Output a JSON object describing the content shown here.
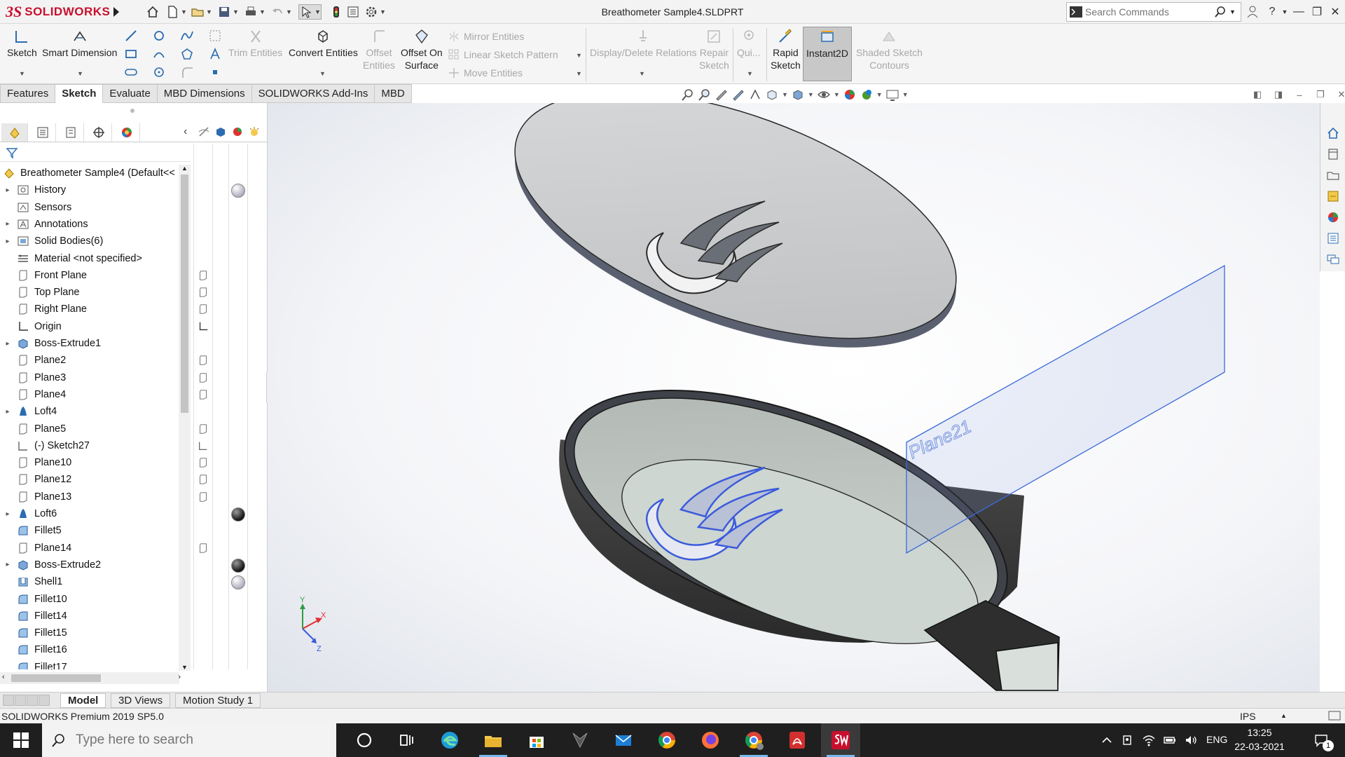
{
  "app": {
    "logo_ds": "3S",
    "logo_name": "SOLIDWORKS",
    "document_title": "Breathometer Sample4.SLDPRT",
    "search_placeholder": "Search Commands"
  },
  "ribbon": {
    "sketch": "Sketch",
    "smart_dimension": "Smart Dimension",
    "trim_entities": "Trim Entities",
    "convert_entities": "Convert Entities",
    "offset_entities_1": "Offset",
    "offset_entities_2": "Entities",
    "offset_on_surface_1": "Offset On",
    "offset_on_surface_2": "Surface",
    "mirror_entities": "Mirror Entities",
    "linear_sketch_pattern": "Linear Sketch Pattern",
    "move_entities": "Move Entities",
    "display_delete_relations": "Display/Delete Relations",
    "repair_sketch_1": "Repair",
    "repair_sketch_2": "Sketch",
    "quick_snaps": "Qui...",
    "rapid_sketch_1": "Rapid",
    "rapid_sketch_2": "Sketch",
    "instant2d": "Instant2D",
    "shaded_sketch_1": "Shaded Sketch",
    "shaded_sketch_2": "Contours"
  },
  "tabs": [
    "Features",
    "Sketch",
    "Evaluate",
    "MBD Dimensions",
    "SOLIDWORKS Add-Ins",
    "MBD"
  ],
  "tree": {
    "root": "Breathometer Sample4  (Default<<",
    "items": [
      {
        "label": "History",
        "icon": "history-icon",
        "expand": true
      },
      {
        "label": "Sensors",
        "icon": "sensors-icon",
        "expand": false
      },
      {
        "label": "Annotations",
        "icon": "annotations-icon",
        "expand": true
      },
      {
        "label": "Solid Bodies(6)",
        "icon": "solid-bodies-icon",
        "expand": true
      },
      {
        "label": "Material <not specified>",
        "icon": "material-icon",
        "expand": false
      },
      {
        "label": "Front Plane",
        "icon": "plane-icon",
        "expand": false
      },
      {
        "label": "Top Plane",
        "icon": "plane-icon",
        "expand": false
      },
      {
        "label": "Right Plane",
        "icon": "plane-icon",
        "expand": false
      },
      {
        "label": "Origin",
        "icon": "origin-icon",
        "expand": false
      },
      {
        "label": "Boss-Extrude1",
        "icon": "extrude-icon",
        "expand": true
      },
      {
        "label": "Plane2",
        "icon": "plane-icon",
        "expand": false
      },
      {
        "label": "Plane3",
        "icon": "plane-icon",
        "expand": false
      },
      {
        "label": "Plane4",
        "icon": "plane-icon",
        "expand": false
      },
      {
        "label": "Loft4",
        "icon": "loft-icon",
        "expand": true
      },
      {
        "label": "Plane5",
        "icon": "plane-icon",
        "expand": false
      },
      {
        "label": "(-) Sketch27",
        "icon": "sketch-icon",
        "expand": false
      },
      {
        "label": "Plane10",
        "icon": "plane-icon",
        "expand": false
      },
      {
        "label": "Plane12",
        "icon": "plane-icon",
        "expand": false
      },
      {
        "label": "Plane13",
        "icon": "plane-icon",
        "expand": false
      },
      {
        "label": "Loft6",
        "icon": "loft-icon",
        "expand": true
      },
      {
        "label": "Fillet5",
        "icon": "fillet-icon",
        "expand": false
      },
      {
        "label": "Plane14",
        "icon": "plane-icon",
        "expand": false
      },
      {
        "label": "Boss-Extrude2",
        "icon": "extrude-icon",
        "expand": true
      },
      {
        "label": "Shell1",
        "icon": "shell-icon",
        "expand": false
      },
      {
        "label": "Fillet10",
        "icon": "fillet-icon",
        "expand": false
      },
      {
        "label": "Fillet14",
        "icon": "fillet-icon",
        "expand": false
      },
      {
        "label": "Fillet15",
        "icon": "fillet-icon",
        "expand": false
      },
      {
        "label": "Fillet16",
        "icon": "fillet-icon",
        "expand": false
      },
      {
        "label": "Fillet17",
        "icon": "fillet-icon",
        "expand": false
      }
    ]
  },
  "viewport": {
    "plane_label": "Plane21",
    "triad_x": "X",
    "triad_y": "Y",
    "triad_z": "Z"
  },
  "bottom_tabs": [
    "Model",
    "3D Views",
    "Motion Study 1"
  ],
  "status": {
    "text": "SOLIDWORKS Premium 2019 SP5.0",
    "units": "IPS"
  },
  "taskbar": {
    "search_placeholder": "Type here to search",
    "language": "ENG",
    "time": "13:25",
    "date": "22-03-2021",
    "notification_count": "1"
  },
  "colors": {
    "brand": "#c8102e",
    "selection_blue": "#3b5bdb",
    "body_dark": "#3a3a3a",
    "body_light": "#c9cbcc"
  }
}
